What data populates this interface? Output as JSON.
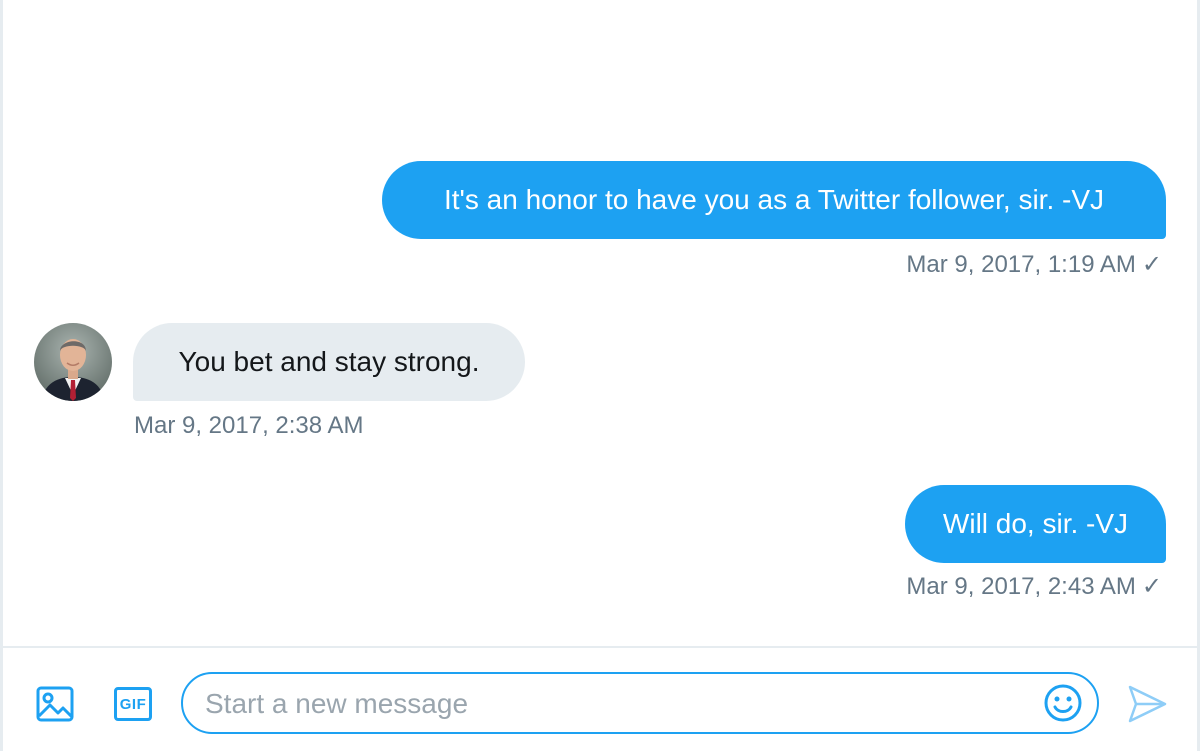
{
  "conversation": {
    "messages": [
      {
        "direction": "sent",
        "text": "It's an honor to have you as a Twitter follower, sir. -VJ",
        "timestamp": "Mar 9, 2017, 1:19 AM",
        "status": "✓"
      },
      {
        "direction": "received",
        "text": "You bet and stay strong.",
        "timestamp": "Mar 9, 2017, 2:38 AM"
      },
      {
        "direction": "sent",
        "text": "Will do, sir. -VJ",
        "timestamp": "Mar 9, 2017, 2:43 AM",
        "status": "✓"
      }
    ]
  },
  "composer": {
    "placeholder": "Start a new message",
    "value": "",
    "gif_label": "GIF",
    "icons": [
      "image-icon",
      "gif-icon",
      "emoji-icon",
      "send-icon"
    ]
  },
  "colors": {
    "accent": "#1da1f2",
    "received_bubble": "#e6ecf0",
    "timestamp": "#657786",
    "border": "#e6ecf0"
  }
}
